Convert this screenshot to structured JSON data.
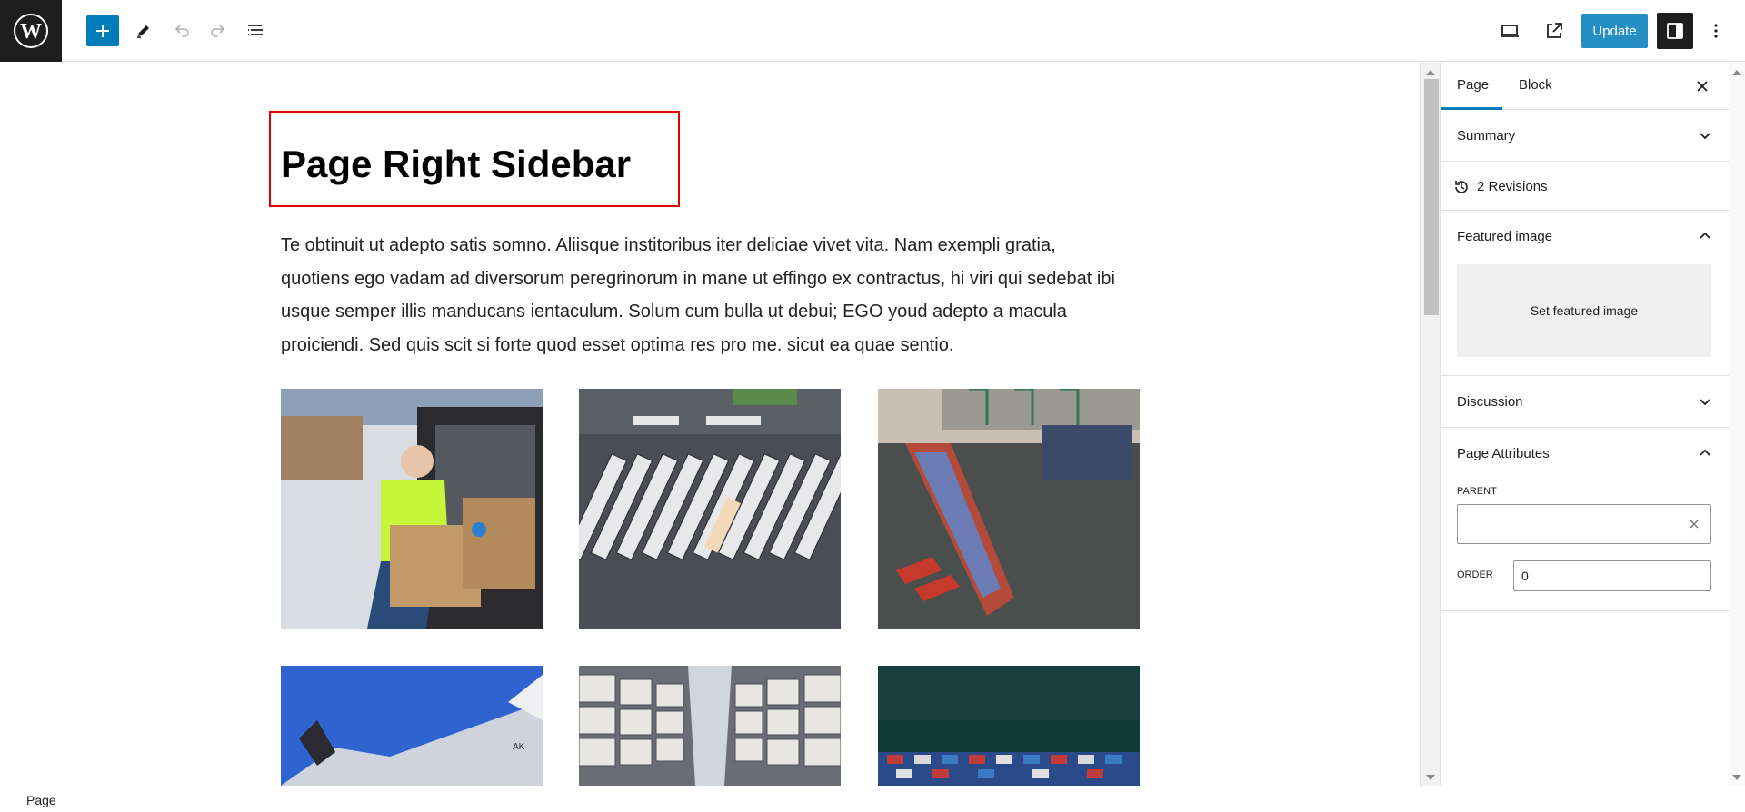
{
  "toolbar": {
    "logo_icon": "wordpress-logo",
    "inserter_icon": "plus-icon",
    "tools_icon": "pencil-icon",
    "undo_icon": "undo-icon",
    "redo_icon": "redo-icon",
    "list_view_icon": "list-view-icon",
    "preview_icon": "desktop-preview-icon",
    "view_page_icon": "external-link-icon",
    "update_label": "Update",
    "settings_icon": "sidebar-toggle-icon",
    "options_icon": "more-vertical-icon"
  },
  "content": {
    "title": "Page Right Sidebar",
    "paragraph_lines": [
      "Te obtinuit ut adepto satis somno. Aliisque institoribus iter deliciae vivet vita. Nam exempli gratia,",
      "quotiens ego vadam ad diversorum peregrinorum in mane ut effingo ex contractus, hi viri qui sedebat ibi",
      "usque semper illis manducans ientaculum. Solum cum bulla ut debui; EGO youd adepto a macula",
      "proiciendi. Sed quis scit si forte quod esset optima res pro me. sicut ea quae sentio."
    ],
    "gallery": [
      {
        "name": "gallery-image-delivery-man"
      },
      {
        "name": "gallery-image-trucks-aerial"
      },
      {
        "name": "gallery-image-cargo-ship-port"
      },
      {
        "name": "gallery-image-airplane"
      },
      {
        "name": "gallery-image-warehouse"
      },
      {
        "name": "gallery-image-containers"
      }
    ]
  },
  "sidebar": {
    "tabs": [
      "Page",
      "Block"
    ],
    "active_tab": "Page",
    "summary_label": "Summary",
    "revisions_label": "2 Revisions",
    "featured_image_label": "Featured image",
    "set_featured_label": "Set featured image",
    "discussion_label": "Discussion",
    "page_attributes_label": "Page Attributes",
    "parent_label": "PARENT",
    "parent_value": "",
    "order_label": "ORDER",
    "order_value": "0"
  },
  "footer": {
    "breadcrumb": "Page"
  },
  "colors": {
    "accent": "#007cba",
    "title_highlight": "#e00000"
  }
}
